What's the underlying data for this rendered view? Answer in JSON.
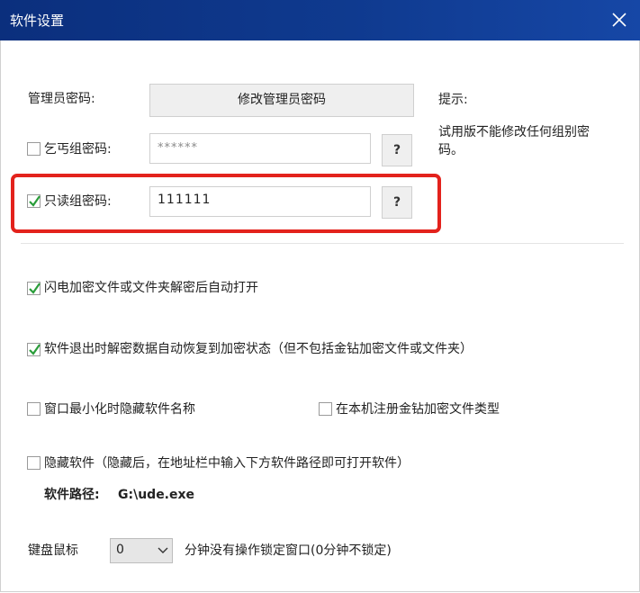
{
  "window": {
    "title": "软件设置"
  },
  "admin": {
    "label": "管理员密码:",
    "button_label": "修改管理员密码"
  },
  "hint": {
    "title": "提示:",
    "text": "试用版不能修改任何组别密码。"
  },
  "beggar_group": {
    "label": "乞丐组密码:",
    "checked": false,
    "placeholder": "******",
    "help_label": "?"
  },
  "readonly_group": {
    "label": "只读组密码:",
    "checked": true,
    "value": "111111",
    "help_label": "?"
  },
  "options": {
    "flash_open": {
      "label": "闪电加密文件或文件夹解密后自动打开",
      "checked": true
    },
    "restore_on_exit": {
      "label": "软件退出时解密数据自动恢复到加密状态（但不包括金钻加密文件或文件夹）",
      "checked": true
    },
    "hide_name_minimized": {
      "label": "窗口最小化时隐藏软件名称",
      "checked": false
    },
    "register_file_type": {
      "label": "在本机注册金钻加密文件类型",
      "checked": false
    },
    "hide_software": {
      "label": "隐藏软件（隐藏后，在地址栏中输入下方软件路径即可打开软件）",
      "checked": false
    }
  },
  "software_path": {
    "label": "软件路径:",
    "value": "G:\\ude.exe"
  },
  "lock": {
    "label": "键盘鼠标",
    "selected": "0",
    "suffix": "分钟没有操作锁定窗口(0分钟不锁定)"
  },
  "colors": {
    "titlebar": "#0f3a8f",
    "highlight": "#e3221c",
    "check": "#2a9d3a"
  }
}
